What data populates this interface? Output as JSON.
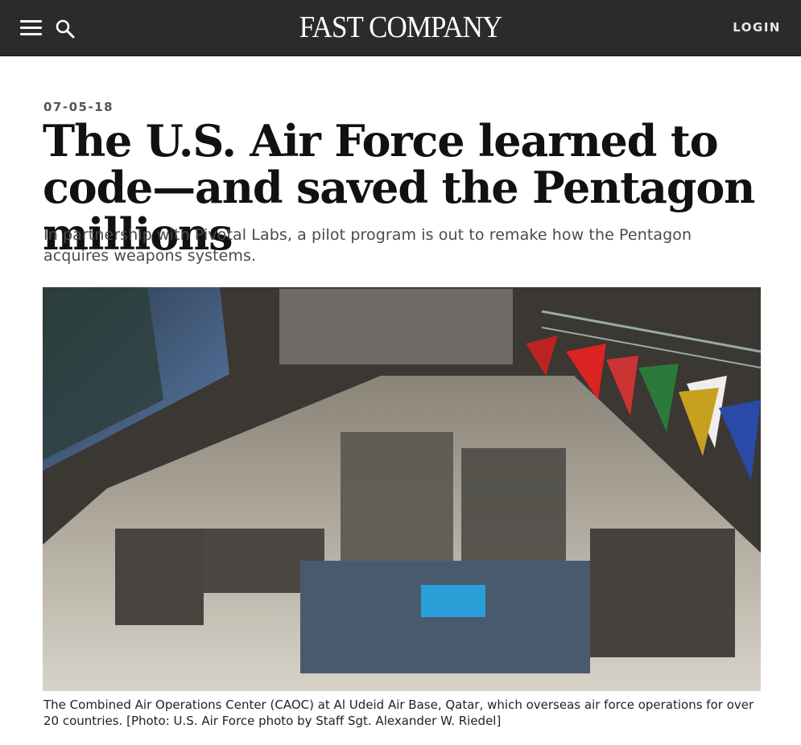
{
  "header": {
    "logo": "FAST COMPANY",
    "login_label": "LOGIN",
    "menu_icon": "hamburger-menu-icon",
    "search_icon": "search-icon"
  },
  "article": {
    "date": "07-05-18",
    "headline": "The U.S. Air Force learned to code—and saved the Pentagon millions",
    "dek": "In partnership with Pivotal Labs, a pilot program is out to remake how the Pentagon acquires weapons systems.",
    "photo_caption": "The Combined Air Operations Center (CAOC) at Al Udeid Air Base, Qatar, which overseas air force operations for over 20 countries. [Photo: U.S. Air Force photo by Staff Sgt. Alexander W. Riedel]"
  },
  "colors": {
    "header_bg": "#2b2b2b",
    "text": "#111111",
    "dek_text": "#4a4a4a"
  }
}
